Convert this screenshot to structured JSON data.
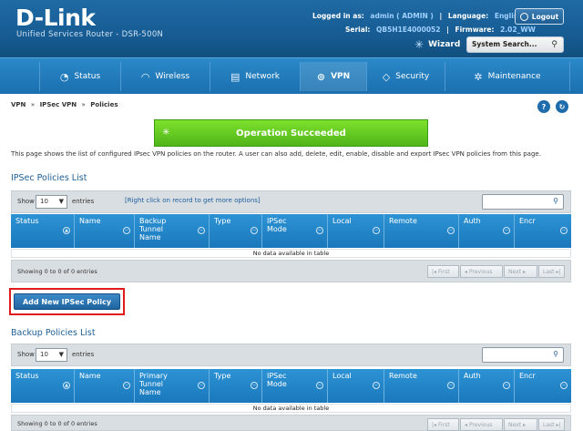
{
  "header": {
    "logo": "D-Link",
    "subtitle": "Unified Services Router - DSR-500N",
    "logged_in_label": "Logged in as:",
    "logged_in_value": "admin ( ADMIN )",
    "language_label": "Language:",
    "language_value": "English [US]",
    "serial_label": "Serial:",
    "serial_value": "QB5H1E4000052",
    "firmware_label": "Firmware:",
    "firmware_value": "2.02_WW",
    "logout_label": "Logout",
    "wizard_label": "Wizard",
    "system_search_label": "System Search..."
  },
  "nav": {
    "items": [
      {
        "label": "Status",
        "icon": "gauge-icon",
        "glyph": "◔"
      },
      {
        "label": "Wireless",
        "icon": "wifi-icon",
        "glyph": "◠"
      },
      {
        "label": "Network",
        "icon": "network-icon",
        "glyph": "▤"
      },
      {
        "label": "VPN",
        "icon": "vpn-lock-icon",
        "glyph": "⊚"
      },
      {
        "label": "Security",
        "icon": "shield-icon",
        "glyph": "◇"
      },
      {
        "label": "Maintenance",
        "icon": "gear-icon",
        "glyph": "✲"
      }
    ],
    "active": "VPN"
  },
  "breadcrumb": {
    "part1": "VPN",
    "sep": "»",
    "part2": "IPSec VPN",
    "part3": "Policies"
  },
  "message": "Operation Succeeded",
  "description": "This page shows the list of configured IPsec VPN policies on the router. A user can also add, delete, edit, enable, disable and export IPsec VPN policies from this page.",
  "ipsec": {
    "title": "IPSec Policies List",
    "show_label": "Show",
    "show_value": "10",
    "entries_label": "entries",
    "hint": "[Right click on record to get more options]",
    "columns": [
      "Status",
      "Name",
      "Backup Tunnel Name",
      "Type",
      "IPSec Mode",
      "Local",
      "Remote",
      "Auth",
      "Encr"
    ],
    "no_data": "No data available in table",
    "info": "Showing 0 to 0 of 0 entries",
    "pager": {
      "first": "First",
      "previous": "Previous",
      "next": "Next",
      "last": "Last"
    }
  },
  "add_button": "Add New IPSec Policy",
  "backup": {
    "title": "Backup Policies List",
    "show_label": "Show",
    "show_value": "10",
    "entries_label": "entries",
    "columns": [
      "Status",
      "Name",
      "Primary Tunnel Name",
      "Type",
      "IPSec Mode",
      "Local",
      "Remote",
      "Auth",
      "Encr"
    ],
    "no_data": "No data available in table",
    "info": "Showing 0 to 0 of 0 entries",
    "pager": {
      "first": "First",
      "previous": "Previous",
      "next": "Next",
      "last": "Last"
    }
  },
  "colors": {
    "header_blue": "#175c93",
    "nav_blue": "#1b6fae",
    "success_green": "#4fb51a",
    "highlight_red": "#e01b1b"
  }
}
